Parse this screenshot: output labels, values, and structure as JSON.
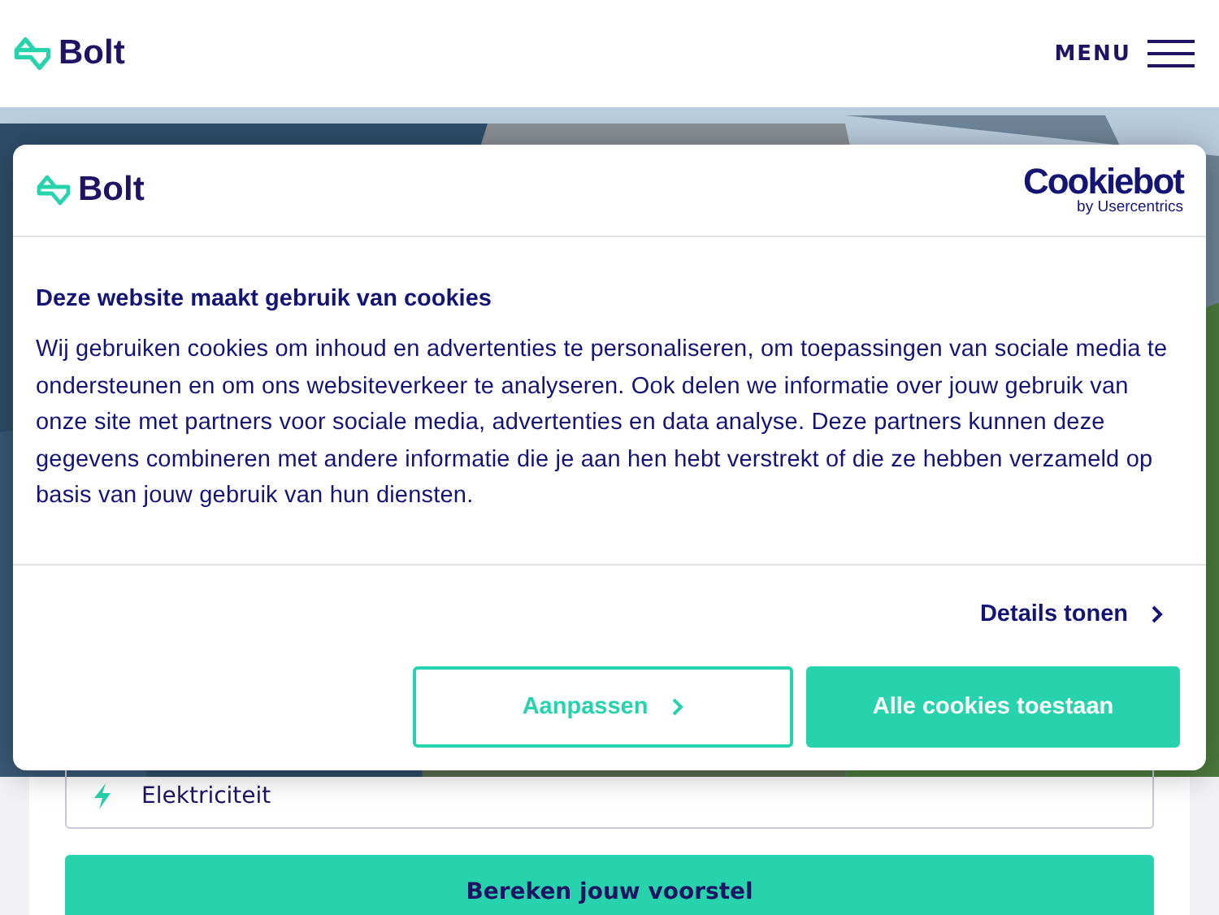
{
  "header": {
    "logo": "Bolt",
    "menu_label": "MENU"
  },
  "form": {
    "energy_select": {
      "value": "Elektriciteit"
    },
    "submit_button": "Bereken jouw voorstel"
  },
  "cookie_dialog": {
    "logo": "Bolt",
    "provider_logo": "Cookiebot",
    "provider_tagline": "by Usercentrics",
    "title": "Deze website maakt gebruik van cookies",
    "body": "Wij gebruiken cookies om inhoud en advertenties te personaliseren, om toepassingen van sociale media te ondersteunen en om ons websiteverkeer te analyseren. Ook delen we informatie over jouw gebruik van onze site met partners voor sociale media, advertenties en data analyse. Deze partners kunnen deze gegevens combineren met andere informatie die je aan hen hebt verstrekt of die ze hebben verzameld op basis van jouw gebruik van hun diensten.",
    "details_link": "Details tonen",
    "buttons": [
      {
        "label": "Aanpassen",
        "kind": "outline"
      },
      {
        "label": "Alle cookies toestaan",
        "kind": "primary"
      }
    ]
  }
}
